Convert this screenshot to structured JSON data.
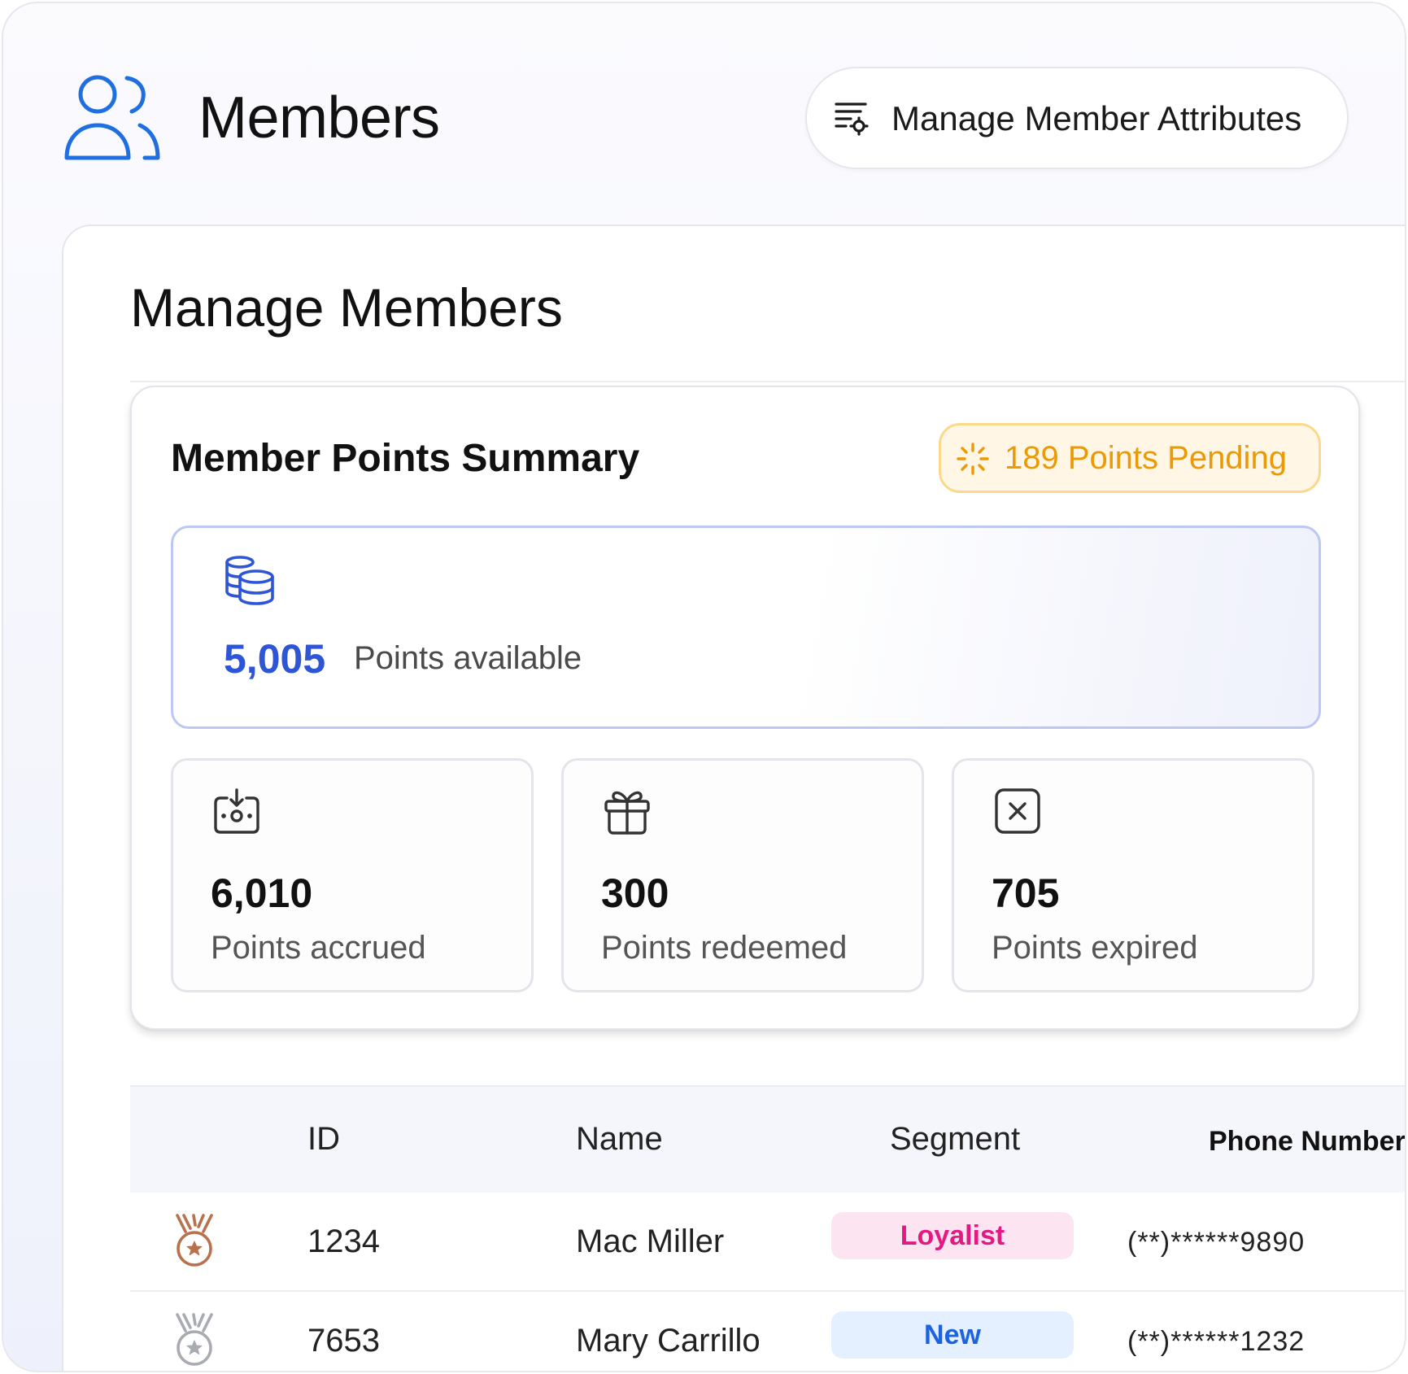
{
  "header": {
    "title": "Members",
    "icon": "users-icon",
    "attributes_button_label": "Manage Member Attributes",
    "attributes_button_icon": "filter-settings-icon"
  },
  "panel": {
    "title": "Manage Members"
  },
  "summary": {
    "title": "Member Points Summary",
    "pending_label": "189 Points Pending",
    "pending_color": "#eb9a06",
    "available": {
      "value": "5,005",
      "label": "Points available",
      "icon": "coins-stack-icon",
      "color": "#2e55d6"
    },
    "stats": [
      {
        "value": "6,010",
        "label": "Points accrued",
        "icon": "deposit-icon"
      },
      {
        "value": "300",
        "label": "Points redeemed",
        "icon": "gift-icon"
      },
      {
        "value": "705",
        "label": "Points expired",
        "icon": "close-square-icon"
      }
    ]
  },
  "table": {
    "columns": [
      "ID",
      "Name",
      "Segment",
      "Phone Number"
    ],
    "rows": [
      {
        "tier": "bronze-medal-icon",
        "id": "1234",
        "name": "Mac Miller",
        "segment": "Loyalist",
        "phone": "(**)******9890"
      },
      {
        "tier": "silver-medal-icon",
        "id": "7653",
        "name": "Mary Carrillo",
        "segment": "New",
        "phone": "(**)******1232"
      }
    ]
  }
}
